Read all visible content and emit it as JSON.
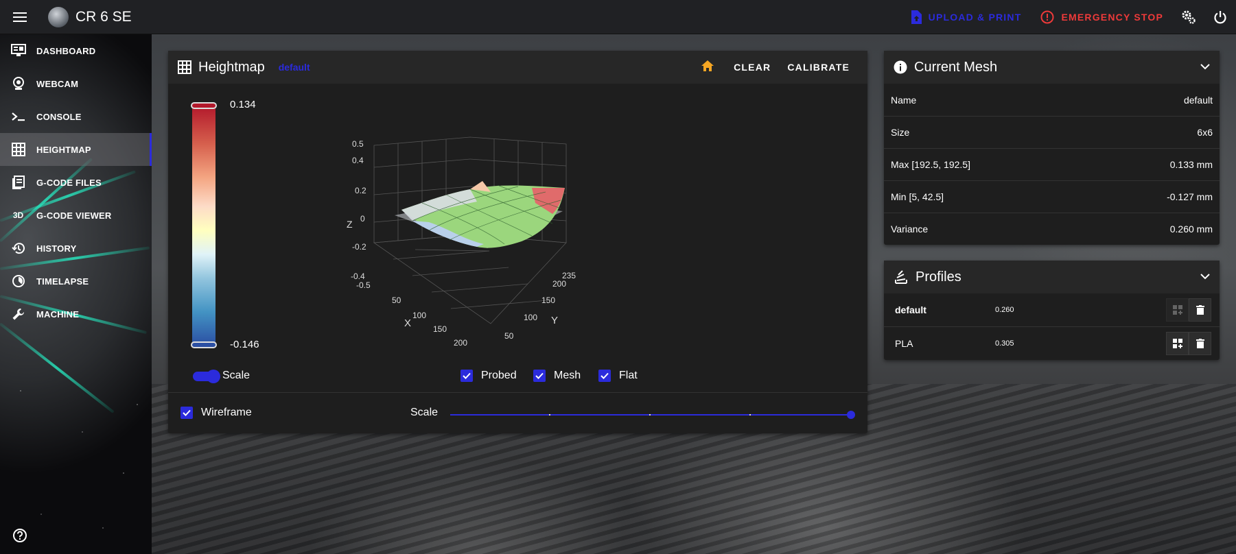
{
  "app": {
    "title": "CR 6 SE"
  },
  "topbar": {
    "upload_label": "UPLOAD & PRINT",
    "estop_label": "EMERGENCY STOP",
    "icons": [
      "menu-icon",
      "upload-file-icon",
      "alert-circle-icon",
      "cog-icon",
      "power-icon"
    ]
  },
  "sidebar": {
    "items": [
      {
        "label": "DASHBOARD",
        "icon": "monitor-dashboard-icon"
      },
      {
        "label": "WEBCAM",
        "icon": "webcam-icon"
      },
      {
        "label": "CONSOLE",
        "icon": "console-icon"
      },
      {
        "label": "HEIGHTMAP",
        "icon": "grid-icon",
        "active": true
      },
      {
        "label": "G-CODE FILES",
        "icon": "file-document-icon"
      },
      {
        "label": "G-CODE VIEWER",
        "icon": "3d-icon",
        "icon_text": "3D"
      },
      {
        "label": "HISTORY",
        "icon": "history-icon"
      },
      {
        "label": "TIMELAPSE",
        "icon": "timelapse-icon"
      },
      {
        "label": "MACHINE",
        "icon": "wrench-icon"
      }
    ]
  },
  "heightmap": {
    "title": "Heightmap",
    "profile": "default",
    "clear_label": "CLEAR",
    "calibrate_label": "CALIBRATE",
    "legend_max": "0.134",
    "legend_min": "-0.146",
    "scale_toggle_label": "Scale",
    "checkboxes": {
      "probed": "Probed",
      "mesh": "Mesh",
      "flat": "Flat"
    },
    "wireframe_label": "Wireframe",
    "scale_slider_label": "Scale",
    "scale_slider_value": 1.0,
    "axes": {
      "z_label": "Z",
      "x_label": "X",
      "y_label": "Y",
      "z_ticks": [
        "0.5",
        "0.4",
        "0.2",
        "0",
        "-0.2",
        "-0.4",
        "-0.5"
      ],
      "x_ticks": [
        "50",
        "100",
        "150",
        "200"
      ],
      "y_ticks": [
        "50",
        "100",
        "150",
        "200",
        "235"
      ]
    }
  },
  "current_mesh": {
    "title": "Current Mesh",
    "rows": [
      {
        "label": "Name",
        "value": "default"
      },
      {
        "label": "Size",
        "value": "6x6"
      },
      {
        "label": "Max [192.5, 192.5]",
        "value": "0.133 mm"
      },
      {
        "label": "Min [5, 42.5]",
        "value": "-0.127 mm"
      },
      {
        "label": "Variance",
        "value": "0.260 mm"
      }
    ]
  },
  "profiles": {
    "title": "Profiles",
    "items": [
      {
        "name": "default",
        "variance": "0.260",
        "active": true
      },
      {
        "name": "PLA",
        "variance": "0.305",
        "active": false
      }
    ]
  },
  "colors": {
    "accent": "#2b2bdc",
    "estop": "#ee3a3a",
    "home": "#f5a623"
  }
}
